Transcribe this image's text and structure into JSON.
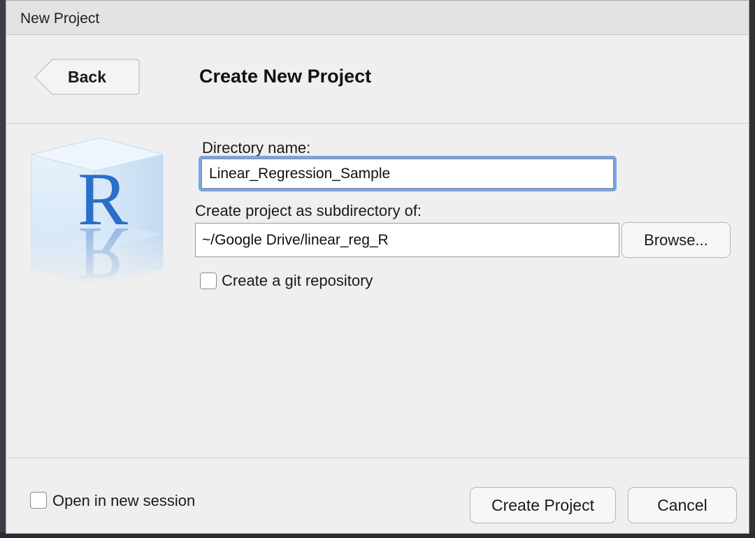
{
  "window": {
    "title": "New Project"
  },
  "header": {
    "back_label": "Back",
    "title": "Create New Project"
  },
  "form": {
    "directory_label": "Directory name:",
    "directory_value": "Linear_Regression_Sample",
    "subdirectory_label": "Create project as subdirectory of:",
    "subdirectory_value": "~/Google Drive/linear_reg_R",
    "browse_label": "Browse...",
    "git_label": "Create a git repository",
    "git_checked": false
  },
  "footer": {
    "session_label": "Open in new session",
    "session_checked": false,
    "create_label": "Create Project",
    "cancel_label": "Cancel"
  },
  "logo": {
    "letter": "R"
  },
  "colors": {
    "focus_ring": "#7aa3e6",
    "logo_blue": "#2a6fc9"
  }
}
